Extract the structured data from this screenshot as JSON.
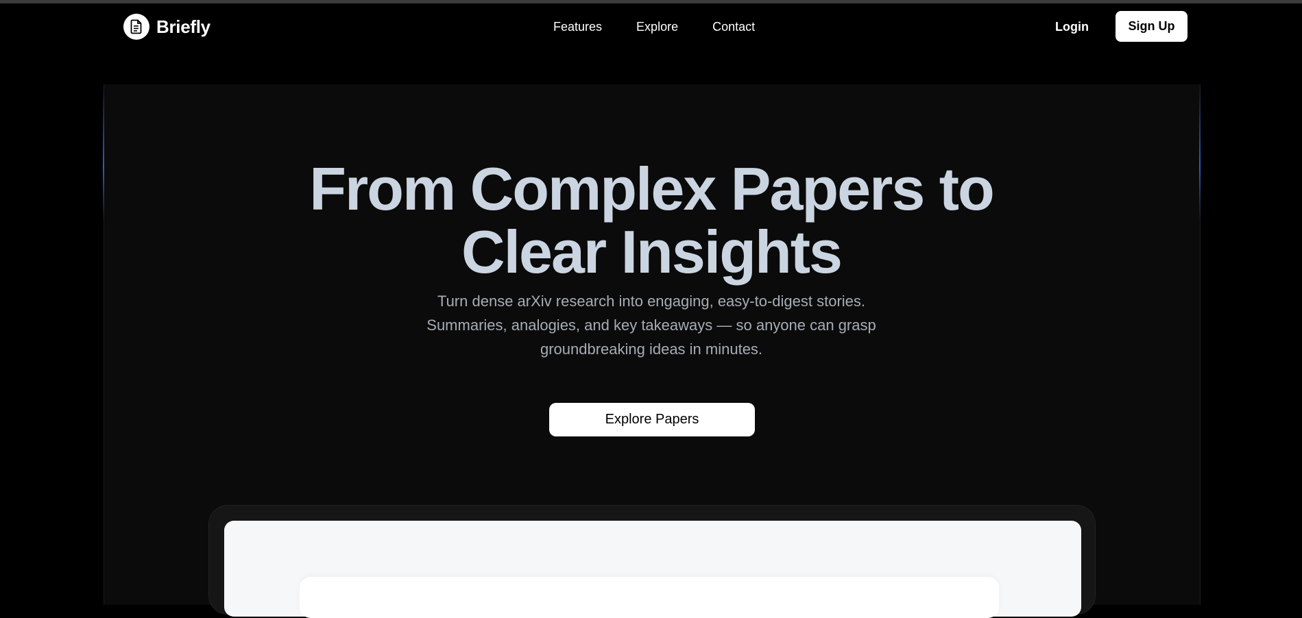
{
  "brand": {
    "name": "Briefly",
    "logo_icon": "document-icon"
  },
  "nav": {
    "links": [
      "Features",
      "Explore",
      "Contact"
    ],
    "login_label": "Login",
    "signup_label": "Sign Up"
  },
  "hero": {
    "headline_line1": "From Complex Papers to",
    "headline_line2": "Clear Insights",
    "subtitle_line1": "Turn dense arXiv research into engaging, easy-to-digest stories.",
    "subtitle_line2": "Summaries, analogies, and key takeaways — so anyone can grasp",
    "subtitle_line3": "groundbreaking ideas in minutes.",
    "cta_label": "Explore Papers"
  },
  "colors": {
    "background": "#000000",
    "hero_background": "#0b0b0b",
    "headline": "#cbd5e1",
    "subtitle": "#a6adb7",
    "accent_glow": "#2c5ec8",
    "button_bg": "#ffffff",
    "button_text": "#000000"
  }
}
